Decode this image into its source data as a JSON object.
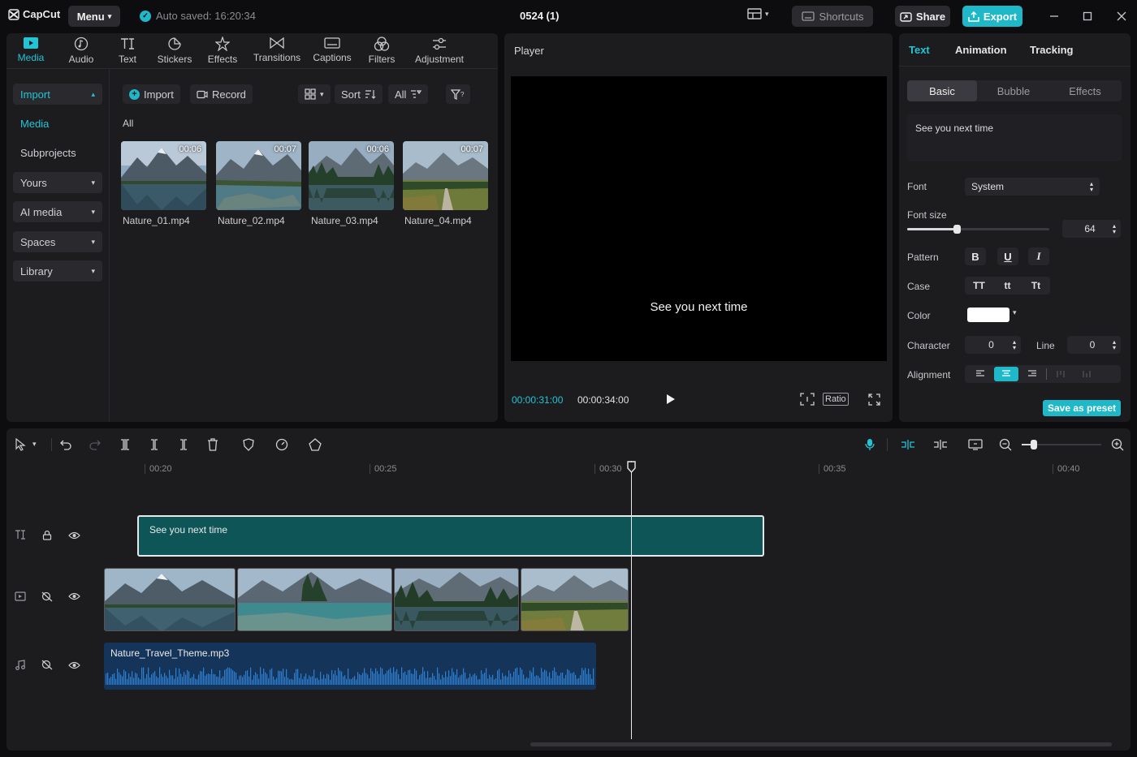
{
  "app": {
    "logo_text": "CapCut",
    "menu_label": "Menu",
    "autosave_text": "Auto saved: 16:20:34",
    "project_title": "0524 (1)",
    "shortcuts_label": "Shortcuts",
    "share_label": "Share",
    "export_label": "Export",
    "accent_color": "#1fb8c9"
  },
  "tool_tabs": [
    {
      "label": "Media",
      "icon": "media-icon",
      "active": true
    },
    {
      "label": "Audio",
      "icon": "audio-icon"
    },
    {
      "label": "Text",
      "icon": "text-icon"
    },
    {
      "label": "Stickers",
      "icon": "stickers-icon"
    },
    {
      "label": "Effects",
      "icon": "effects-icon"
    },
    {
      "label": "Transitions",
      "icon": "transitions-icon"
    },
    {
      "label": "Captions",
      "icon": "captions-icon"
    },
    {
      "label": "Filters",
      "icon": "filters-icon"
    },
    {
      "label": "Adjustment",
      "icon": "adjustment-icon"
    }
  ],
  "sidebar": {
    "items": [
      {
        "label": "Import"
      },
      {
        "label": "Media"
      },
      {
        "label": "Subprojects"
      },
      {
        "label": "Yours"
      },
      {
        "label": "AI media"
      },
      {
        "label": "Spaces"
      },
      {
        "label": "Library"
      }
    ]
  },
  "media_toolbar": {
    "import_label": "Import",
    "record_label": "Record",
    "sort_label": "Sort",
    "filter_label": "All"
  },
  "media": {
    "section_label": "All",
    "items": [
      {
        "name": "Nature_01.mp4",
        "duration": "00:06"
      },
      {
        "name": "Nature_02.mp4",
        "duration": "00:07"
      },
      {
        "name": "Nature_03.mp4",
        "duration": "00:06"
      },
      {
        "name": "Nature_04.mp4",
        "duration": "00:07"
      }
    ]
  },
  "player": {
    "title": "Player",
    "caption": "See you next time",
    "current_time": "00:00:31:00",
    "total_time": "00:00:34:00",
    "ratio_label": "Ratio"
  },
  "props": {
    "tabs": [
      "Text",
      "Animation",
      "Tracking"
    ],
    "segments": [
      "Basic",
      "Bubble",
      "Effects"
    ],
    "text_value": "See you next time",
    "font_label": "Font",
    "font_value": "System",
    "font_size_label": "Font size",
    "font_size_value": "64",
    "font_size_fraction": 0.35,
    "pattern_label": "Pattern",
    "pattern_buttons": [
      "B",
      "U",
      "I"
    ],
    "case_label": "Case",
    "case_buttons": [
      "TT",
      "tt",
      "Tt"
    ],
    "color_label": "Color",
    "text_color": "#ffffff",
    "character_label": "Character",
    "character_value": "0",
    "line_label": "Line",
    "line_value": "0",
    "alignment_label": "Alignment",
    "save_preset_label": "Save as preset"
  },
  "timeline": {
    "ruler": [
      "00:20",
      "00:25",
      "00:30",
      "00:35",
      "00:40"
    ],
    "text_clip": "See you next time",
    "audio_clip": "Nature_Travel_Theme.mp3",
    "zoom_fraction": 0.15
  }
}
